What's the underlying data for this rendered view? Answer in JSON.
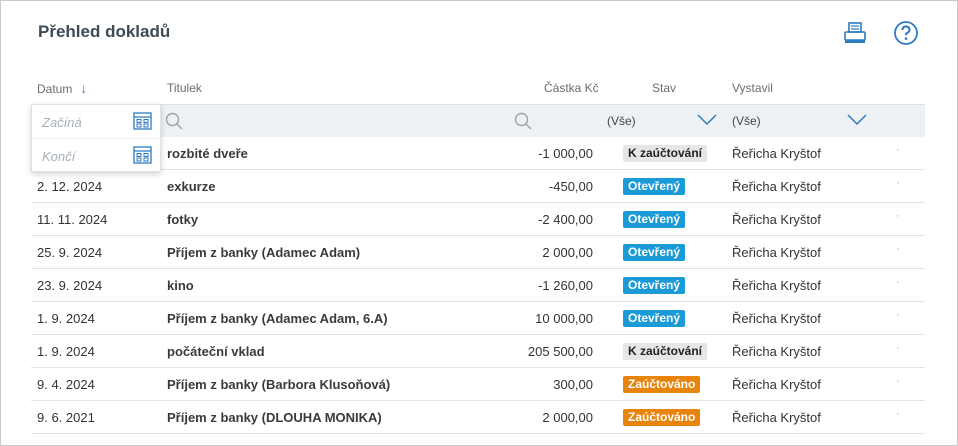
{
  "header": {
    "title": "Přehled dokladů",
    "print_icon": "printer-icon",
    "help_icon": "help-icon",
    "accent": "#2c7bc0"
  },
  "columns": {
    "date": "Datum",
    "title": "Titulek",
    "amount": "Částka Kč",
    "status": "Stav",
    "author": "Vystavil"
  },
  "filters": {
    "date_from_placeholder": "Začíná",
    "date_to_placeholder": "Končí",
    "status_value": "(Vše)",
    "author_value": "(Vše)"
  },
  "status_colors": {
    "kz": "#e6e6e6",
    "ot": "#1a9bd7",
    "za": "#e8830c"
  },
  "rows": [
    {
      "date": "",
      "title": "rozbité dveře",
      "amount": "-1 000,00",
      "status": "K zaúčtování",
      "status_kind": "kz",
      "author": "Řeřicha Kryštof",
      "dot": "·"
    },
    {
      "date": "2. 12. 2024",
      "title": "exkurze",
      "amount": "-450,00",
      "status": "Otevřený",
      "status_kind": "ot",
      "author": "Řeřicha Kryštof",
      "dot": "·"
    },
    {
      "date": "11. 11. 2024",
      "title": "fotky",
      "amount": "-2 400,00",
      "status": "Otevřený",
      "status_kind": "ot",
      "author": "Řeřicha Kryštof",
      "dot": "·"
    },
    {
      "date": "25. 9. 2024",
      "title": "Příjem z banky (Adamec Adam)",
      "amount": "2 000,00",
      "status": "Otevřený",
      "status_kind": "ot",
      "author": "Řeřicha Kryštof",
      "dot": "·"
    },
    {
      "date": "23. 9. 2024",
      "title": "kino",
      "amount": "-1 260,00",
      "status": "Otevřený",
      "status_kind": "ot",
      "author": "Řeřicha Kryštof",
      "dot": "·"
    },
    {
      "date": "1. 9. 2024",
      "title": "Příjem z banky (Adamec Adam, 6.A)",
      "amount": "10 000,00",
      "status": "Otevřený",
      "status_kind": "ot",
      "author": "Řeřicha Kryštof",
      "dot": "·"
    },
    {
      "date": "1. 9. 2024",
      "title": "počáteční vklad",
      "amount": "205 500,00",
      "status": "K zaúčtování",
      "status_kind": "kz",
      "author": "Řeřicha Kryštof",
      "dot": "·"
    },
    {
      "date": "9. 4. 2024",
      "title": "Příjem z banky (Barbora Klusoňová)",
      "amount": "300,00",
      "status": "Zaúčtováno",
      "status_kind": "za",
      "author": "Řeřicha Kryštof",
      "dot": "·"
    },
    {
      "date": "9. 6. 2021",
      "title": "Příjem z banky (DLOUHA MONIKA)",
      "amount": "2 000,00",
      "status": "Zaúčtováno",
      "status_kind": "za",
      "author": "Řeřicha Kryštof",
      "dot": "·"
    }
  ]
}
